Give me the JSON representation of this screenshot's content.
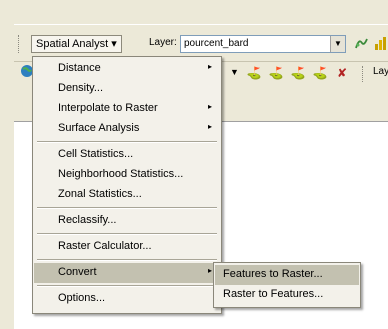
{
  "toolbar": {
    "spatial_analyst_label": "Spatial Analyst ▾",
    "layer_label": "Layer:",
    "layer_value": "pourcent_bard",
    "partial_label": "Lay"
  },
  "menu": {
    "items": [
      {
        "label": "Distance",
        "submenu": true
      },
      {
        "label": "Density...",
        "submenu": false
      },
      {
        "label": "Interpolate to Raster",
        "submenu": true
      },
      {
        "label": "Surface Analysis",
        "submenu": true
      },
      {
        "label": "Cell Statistics...",
        "submenu": false
      },
      {
        "label": "Neighborhood Statistics...",
        "submenu": false
      },
      {
        "label": "Zonal Statistics...",
        "submenu": false
      },
      {
        "label": "Reclassify...",
        "submenu": false
      },
      {
        "label": "Raster Calculator...",
        "submenu": false
      },
      {
        "label": "Convert",
        "submenu": true,
        "active": true
      },
      {
        "label": "Options...",
        "submenu": false
      }
    ]
  },
  "submenu": {
    "items": [
      {
        "label": "Features to Raster...",
        "active": true
      },
      {
        "label": "Raster to Features..."
      }
    ]
  },
  "icons": {
    "arrow": "▸",
    "dropdown": "▼"
  }
}
